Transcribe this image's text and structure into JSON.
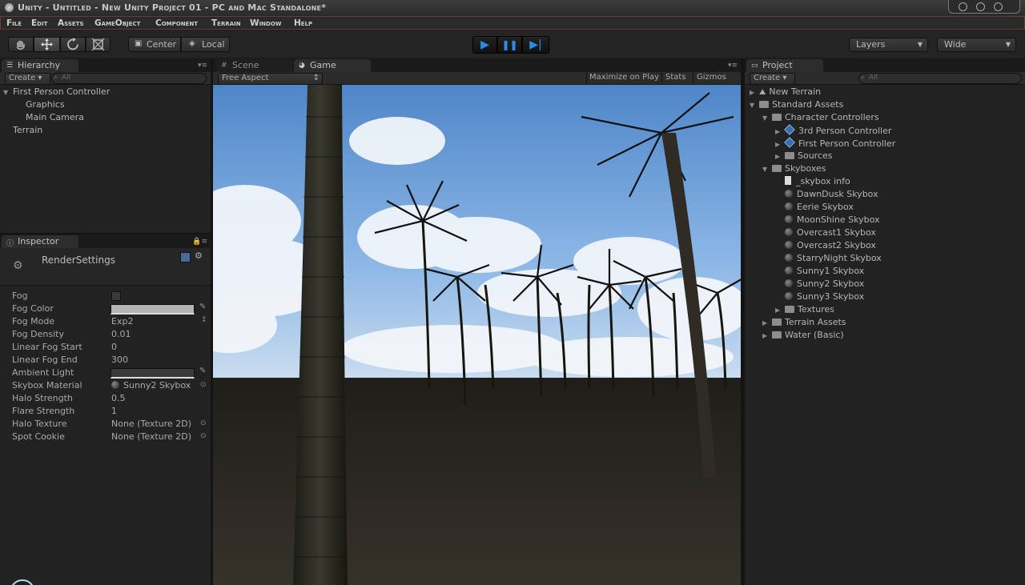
{
  "window": {
    "title": "Unity - Untitled - New Unity Project 01 - PC and Mac Standalone*"
  },
  "menu": [
    "File",
    "Edit",
    "Assets",
    "GameObject",
    "Component",
    "Terrain",
    "Window",
    "Help"
  ],
  "toolbar": {
    "tools": [
      "hand-icon",
      "move-icon",
      "rotate-icon",
      "scale-icon"
    ],
    "pivot_label": "Center",
    "space_label": "Local",
    "layers_label": "Layers",
    "layout_label": "Wide"
  },
  "hierarchy": {
    "tab": "Hierarchy",
    "create": "Create",
    "search_placeholder": "All",
    "items": [
      {
        "label": "First Person Controller",
        "depth": 0,
        "arrow": "expanded"
      },
      {
        "label": "Graphics",
        "depth": 1,
        "arrow": ""
      },
      {
        "label": "Main Camera",
        "depth": 1,
        "arrow": ""
      },
      {
        "label": "Terrain",
        "depth": 0,
        "arrow": ""
      }
    ]
  },
  "inspector": {
    "tab": "Inspector",
    "header": "RenderSettings",
    "props": [
      {
        "label": "Fog",
        "value": "",
        "kind": "checkbox"
      },
      {
        "label": "Fog Color",
        "value": "",
        "kind": "color",
        "color": "#b4b4b4"
      },
      {
        "label": "Fog Mode",
        "value": "Exp2",
        "kind": "enum"
      },
      {
        "label": "Fog Density",
        "value": "0.01",
        "kind": "text"
      },
      {
        "label": "Linear Fog Start",
        "value": "0",
        "kind": "text"
      },
      {
        "label": "Linear Fog End",
        "value": "300",
        "kind": "text"
      },
      {
        "label": "Ambient Light",
        "value": "",
        "kind": "color",
        "color": "#3a3a3a"
      },
      {
        "label": "Skybox Material",
        "value": "Sunny2 Skybox",
        "kind": "object"
      },
      {
        "label": "Halo Strength",
        "value": "0.5",
        "kind": "text"
      },
      {
        "label": "Flare Strength",
        "value": "1",
        "kind": "text"
      },
      {
        "label": "Halo Texture",
        "value": "None (Texture 2D)",
        "kind": "object"
      },
      {
        "label": "Spot Cookie",
        "value": "None (Texture 2D)",
        "kind": "object"
      }
    ]
  },
  "center": {
    "tabs": [
      {
        "label": "Scene",
        "active": false
      },
      {
        "label": "Game",
        "active": true
      }
    ],
    "aspect": "Free Aspect",
    "buttons": [
      "Maximize on Play",
      "Stats",
      "Gizmos"
    ]
  },
  "project": {
    "tab": "Project",
    "create": "Create",
    "search_placeholder": "All",
    "items": [
      {
        "label": "New Terrain",
        "depth": 0,
        "icon": "terrain-icon",
        "arrow": "collapsed"
      },
      {
        "label": "Standard Assets",
        "depth": 0,
        "icon": "folder-icon",
        "arrow": "expanded"
      },
      {
        "label": "Character Controllers",
        "depth": 1,
        "icon": "folder-icon",
        "arrow": "expanded"
      },
      {
        "label": "3rd Person Controller",
        "depth": 2,
        "icon": "prefab-icon",
        "arrow": "collapsed"
      },
      {
        "label": "First Person Controller",
        "depth": 2,
        "icon": "prefab-icon",
        "arrow": "collapsed"
      },
      {
        "label": "Sources",
        "depth": 2,
        "icon": "folder-icon",
        "arrow": "collapsed"
      },
      {
        "label": "Skyboxes",
        "depth": 1,
        "icon": "folder-icon",
        "arrow": "expanded"
      },
      {
        "label": "_skybox info",
        "depth": 2,
        "icon": "document-icon",
        "arrow": ""
      },
      {
        "label": "DawnDusk Skybox",
        "depth": 2,
        "icon": "material-icon",
        "arrow": ""
      },
      {
        "label": "Eerie Skybox",
        "depth": 2,
        "icon": "material-icon",
        "arrow": ""
      },
      {
        "label": "MoonShine Skybox",
        "depth": 2,
        "icon": "material-icon",
        "arrow": ""
      },
      {
        "label": "Overcast1 Skybox",
        "depth": 2,
        "icon": "material-icon",
        "arrow": ""
      },
      {
        "label": "Overcast2 Skybox",
        "depth": 2,
        "icon": "material-icon",
        "arrow": ""
      },
      {
        "label": "StarryNight Skybox",
        "depth": 2,
        "icon": "material-icon",
        "arrow": ""
      },
      {
        "label": "Sunny1 Skybox",
        "depth": 2,
        "icon": "material-icon",
        "arrow": ""
      },
      {
        "label": "Sunny2 Skybox",
        "depth": 2,
        "icon": "material-icon",
        "arrow": ""
      },
      {
        "label": "Sunny3 Skybox",
        "depth": 2,
        "icon": "material-icon",
        "arrow": ""
      },
      {
        "label": "Textures",
        "depth": 2,
        "icon": "folder-icon",
        "arrow": "collapsed"
      },
      {
        "label": "Terrain Assets",
        "depth": 1,
        "icon": "folder-icon",
        "arrow": "collapsed"
      },
      {
        "label": "Water (Basic)",
        "depth": 1,
        "icon": "folder-icon",
        "arrow": "collapsed"
      }
    ]
  },
  "colors": {
    "accent": "#2f8be8",
    "panel": "#222222",
    "sky": "#6a9fd8",
    "ground": "#2b2820"
  }
}
